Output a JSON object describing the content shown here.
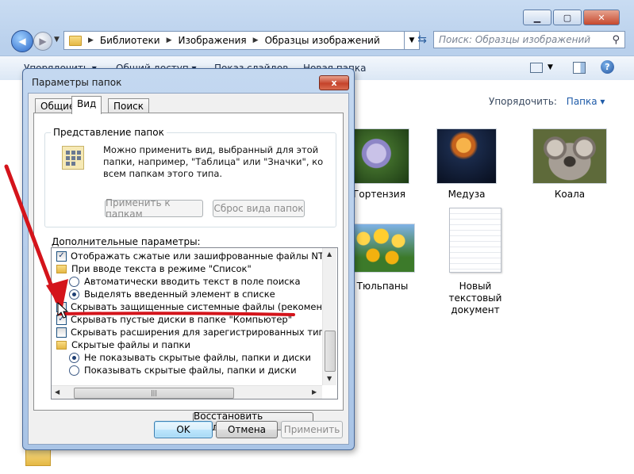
{
  "explorer": {
    "address": {
      "crumbs": [
        "Библиотеки",
        "Изображения",
        "Образцы изображений"
      ]
    },
    "search_placeholder": "Поиск: Образцы изображений",
    "toolbar": {
      "items": [
        "Упорядочить ▾",
        "Общий доступ ▾",
        "Показ слайдов",
        "Новая папка"
      ]
    },
    "arrange_label": "Упорядочить:",
    "arrange_value": "Папка ▾",
    "files": [
      {
        "name": "Гортензия"
      },
      {
        "name": "Медуза"
      },
      {
        "name": "Коала"
      },
      {
        "name": "Тюльпаны"
      },
      {
        "name": "Новый текстовый документ"
      }
    ]
  },
  "dialog": {
    "title": "Параметры папок",
    "close_label": "x",
    "tabs": [
      "Общие",
      "Вид",
      "Поиск"
    ],
    "active_tab": "Вид",
    "folder_view": {
      "group_label": "Представление папок",
      "description": "Можно применить вид, выбранный для этой папки, например, \"Таблица\" или \"Значки\", ко всем папкам этого типа.",
      "apply_button": "Применить к папкам",
      "reset_button": "Сброс вида папок"
    },
    "advanced_label": "Дополнительные параметры:",
    "advanced_items": [
      {
        "type": "checkbox",
        "checked": true,
        "indent": 0,
        "label": "Отображать сжатые или зашифрованные файлы NTFS д"
      },
      {
        "type": "folder",
        "indent": 0,
        "label": "При вводе текста в режиме \"Список\""
      },
      {
        "type": "radio",
        "checked": false,
        "indent": 1,
        "label": "Автоматически вводить текст в поле поиска"
      },
      {
        "type": "radio",
        "checked": true,
        "indent": 1,
        "label": "Выделять введенный элемент в списке"
      },
      {
        "type": "checkbox",
        "checked": true,
        "indent": 0,
        "label": "Скрывать защищенные системные файлы (рекоменду"
      },
      {
        "type": "checkbox",
        "checked": true,
        "indent": 0,
        "label": "Скрывать пустые диски в папке \"Компьютер\""
      },
      {
        "type": "checkbox",
        "checked": false,
        "indent": 0,
        "label": "Скрывать расширения для зарегистрированных типов ф"
      },
      {
        "type": "folder",
        "indent": 0,
        "label": "Скрытые файлы и папки"
      },
      {
        "type": "radio",
        "checked": true,
        "indent": 1,
        "label": "Не показывать скрытые файлы, папки и диски"
      },
      {
        "type": "radio",
        "checked": false,
        "indent": 1,
        "label": "Показывать скрытые файлы, папки и диски"
      }
    ],
    "restore_button": "Восстановить умолчания",
    "ok_button": "OK",
    "cancel_button": "Отмена",
    "apply_button": "Применить"
  },
  "colors": {
    "annotation_red": "#d4141b",
    "link_blue": "#1f5ba8"
  }
}
